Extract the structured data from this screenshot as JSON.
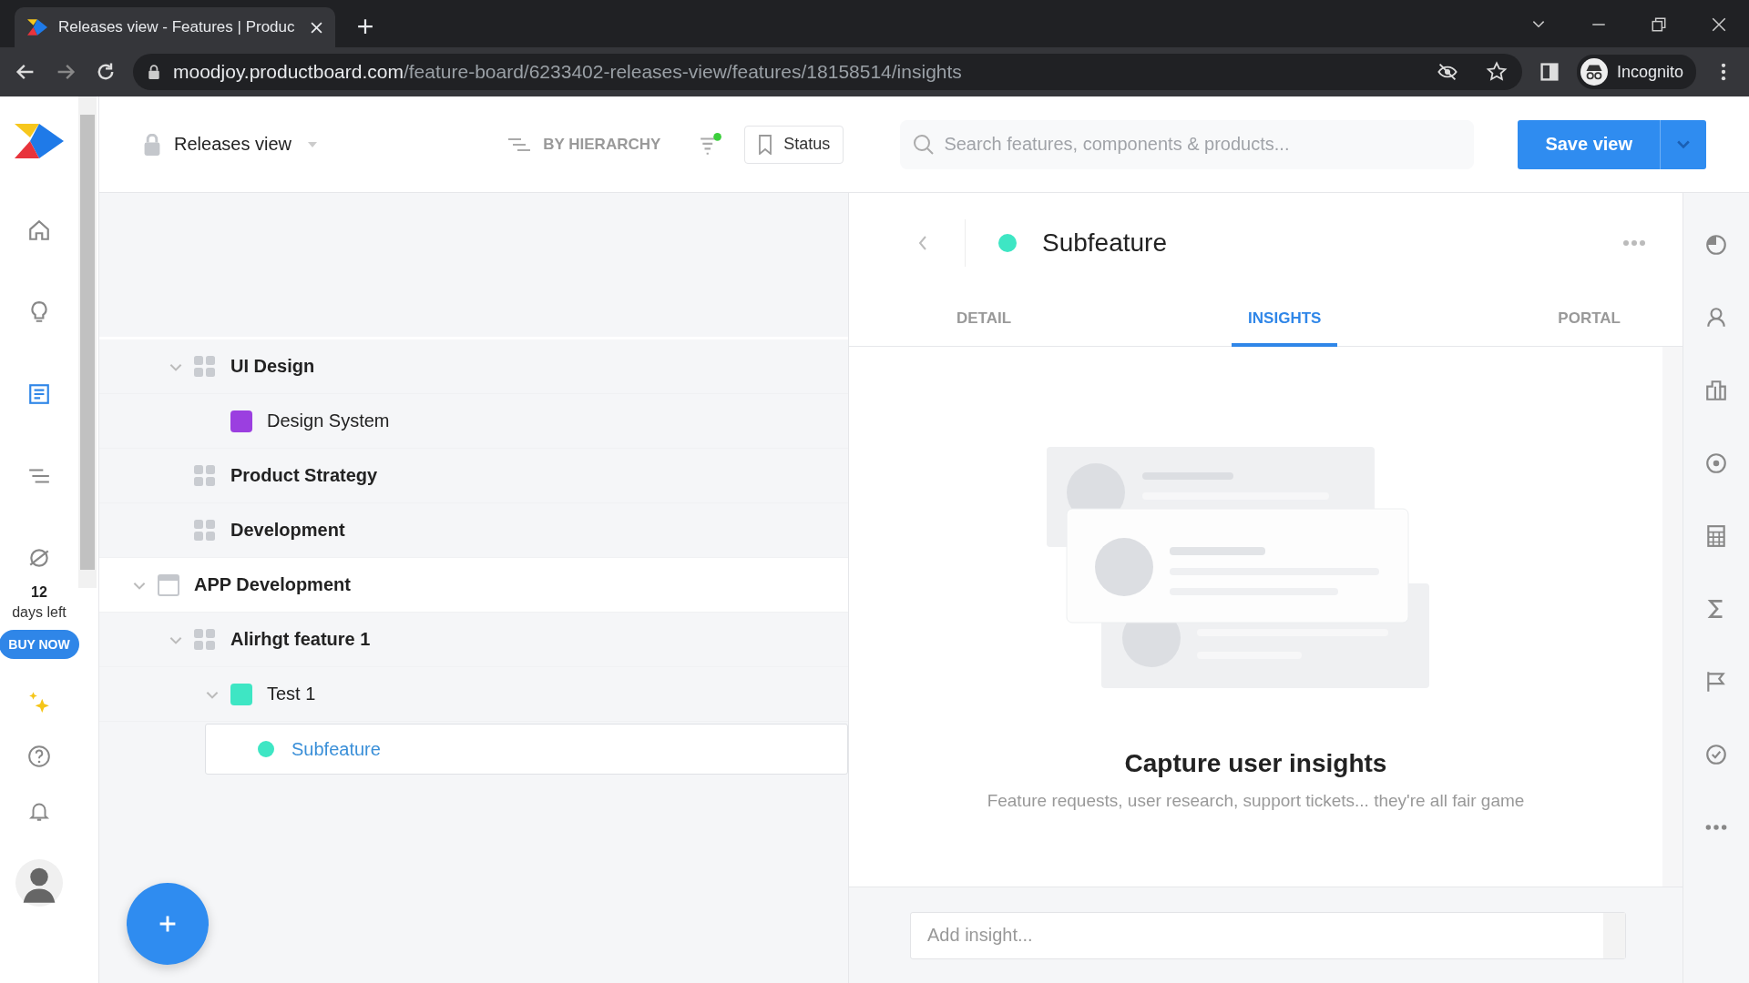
{
  "browser": {
    "tab_title": "Releases view - Features | Produc",
    "url_host": "moodjoy.productboard.com",
    "url_path": "/feature-board/6233402-releases-view/features/18158514/insights",
    "profile": "Incognito"
  },
  "nav": {
    "items": [
      {
        "kind": "home",
        "selected": false
      },
      {
        "kind": "insights",
        "selected": false
      },
      {
        "kind": "features",
        "selected": true
      },
      {
        "kind": "roadmap",
        "selected": false
      },
      {
        "kind": "portal",
        "selected": false
      }
    ],
    "trial_days": "12",
    "trial_label": "days left",
    "buy_button": "BUY NOW"
  },
  "header": {
    "view_name": "Releases view",
    "grouping": "BY HIERARCHY",
    "filter_active": true,
    "status_button": "Status",
    "search": {
      "placeholder": "Search features, components & products..."
    },
    "save_button": "Save view"
  },
  "tree": [
    {
      "kind": "component",
      "label": "UI Design",
      "expanded": true,
      "selected": false,
      "children": [
        {
          "kind": "feature",
          "label": "Design System",
          "color": "#9b3fe0",
          "selected": false
        }
      ]
    },
    {
      "kind": "component",
      "label": "Product Strategy",
      "selected": false
    },
    {
      "kind": "component",
      "label": "Development",
      "selected": false
    },
    {
      "kind": "product",
      "label": "APP Development",
      "expanded": true,
      "selected": false,
      "children": [
        {
          "kind": "component",
          "label": "Alirhgt feature 1",
          "expanded": true,
          "selected": false,
          "children": [
            {
              "kind": "feature",
              "label": "Test 1",
              "color": "#3ee6c4",
              "expanded": true,
              "selected": false,
              "children": [
                {
                  "kind": "subfeature",
                  "label": "Subfeature",
                  "color": "#3ee6c4",
                  "selected": true
                }
              ]
            }
          ]
        }
      ]
    }
  ],
  "detail": {
    "title": "Subfeature",
    "color": "#3ee6c4",
    "tabs": [
      {
        "label": "DETAIL",
        "selected": false
      },
      {
        "label": "INSIGHTS",
        "selected": true
      },
      {
        "label": "PORTAL",
        "selected": false
      }
    ],
    "empty_title": "Capture user insights",
    "empty_text": "Feature requests, user research, support tickets... they're all fair game",
    "insight_field": {
      "placeholder": "Add insight..."
    }
  }
}
